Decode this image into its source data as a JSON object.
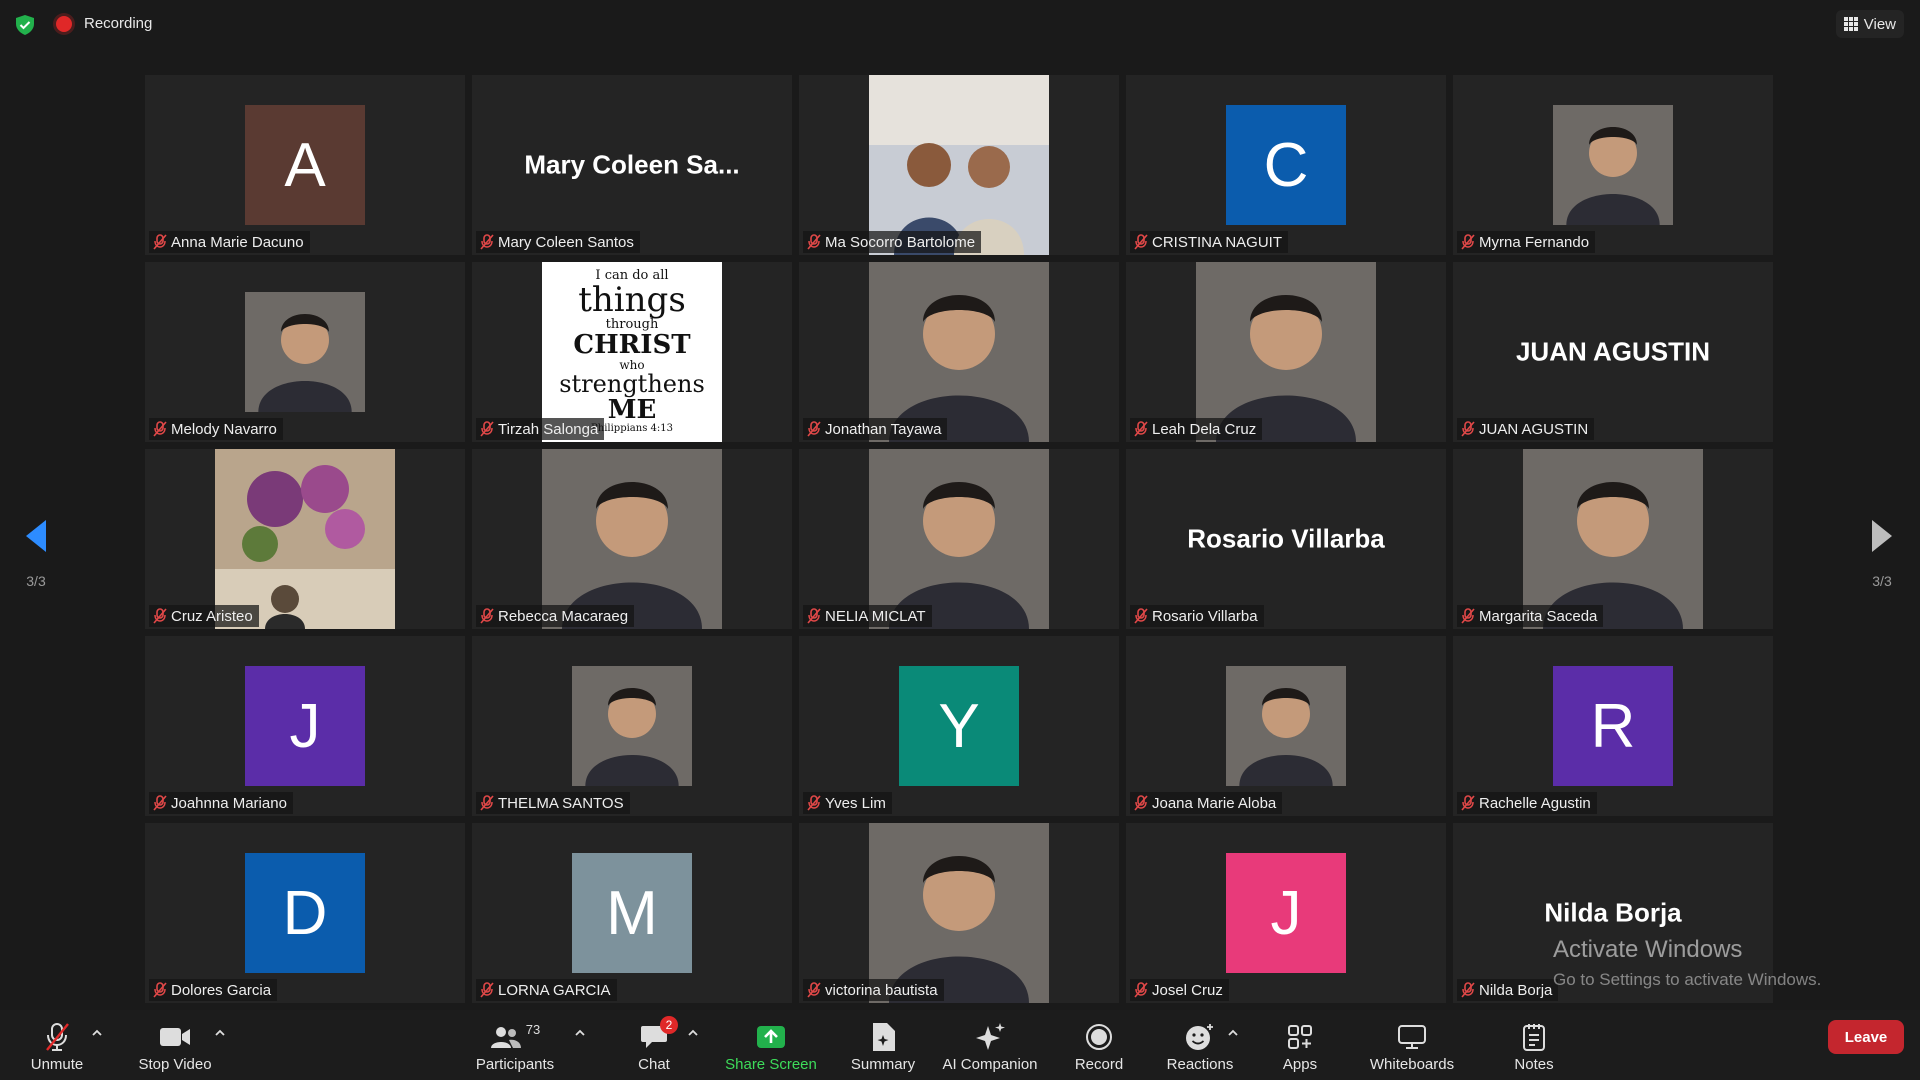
{
  "topbar": {
    "recording_label": "Recording",
    "view_label": "View"
  },
  "pager": {
    "left_page": "3/3",
    "right_page": "3/3"
  },
  "participants": [
    {
      "name": "Anna Marie Dacuno",
      "type": "letter",
      "letter": "A",
      "color": "#5a3a32"
    },
    {
      "name": "Mary Coleen Santos",
      "type": "text",
      "display": "Mary Coleen Sa..."
    },
    {
      "name": "Ma Socorro Bartolome",
      "type": "photo",
      "icon": "couple-photo"
    },
    {
      "name": "CRISTINA NAGUIT",
      "type": "letter",
      "letter": "C",
      "color": "#0b5cad"
    },
    {
      "name": "Myrna Fernando",
      "type": "photo",
      "icon": "portrait-photo",
      "small": true
    },
    {
      "name": "Melody Navarro",
      "type": "photo",
      "icon": "portrait-photo",
      "small": true
    },
    {
      "name": "Tirzah Salonga",
      "type": "quote",
      "lines": [
        "I can do all",
        "things",
        "through",
        "CHRIST",
        "who",
        "strengthens",
        "ME",
        "Philippians 4:13"
      ]
    },
    {
      "name": "Jonathan Tayawa",
      "type": "photo",
      "icon": "portrait-photo"
    },
    {
      "name": "Leah Dela Cruz",
      "type": "photo",
      "icon": "portrait-photo"
    },
    {
      "name": "JUAN AGUSTIN",
      "type": "text",
      "display": "JUAN AGUSTIN"
    },
    {
      "name": "Cruz Aristeo",
      "type": "photo",
      "icon": "flowers-photo"
    },
    {
      "name": "Rebecca Macaraeg",
      "type": "photo",
      "icon": "portrait-photo"
    },
    {
      "name": "NELIA MICLAT",
      "type": "photo",
      "icon": "portrait-photo"
    },
    {
      "name": "Rosario Villarba",
      "type": "text",
      "display": "Rosario Villarba"
    },
    {
      "name": "Margarita Saceda",
      "type": "photo",
      "icon": "portrait-photo"
    },
    {
      "name": "Joahnna Mariano",
      "type": "letter",
      "letter": "J",
      "color": "#5b2da8"
    },
    {
      "name": "THELMA SANTOS",
      "type": "photo",
      "icon": "portrait-photo",
      "small": true
    },
    {
      "name": "Yves Lim",
      "type": "letter",
      "letter": "Y",
      "color": "#0a8a78"
    },
    {
      "name": "Joana Marie Aloba",
      "type": "photo",
      "icon": "portrait-photo",
      "small": true
    },
    {
      "name": "Rachelle Agustin",
      "type": "letter",
      "letter": "R",
      "color": "#5b2da8"
    },
    {
      "name": "Dolores Garcia",
      "type": "letter",
      "letter": "D",
      "color": "#0b5cad"
    },
    {
      "name": "LORNA GARCIA",
      "type": "letter",
      "letter": "M",
      "color": "#7d929c"
    },
    {
      "name": "victorina bautista",
      "type": "photo",
      "icon": "portrait-photo"
    },
    {
      "name": "Josel Cruz",
      "type": "letter",
      "letter": "J",
      "color": "#e83a7a"
    },
    {
      "name": "Nilda Borja",
      "type": "text",
      "display": "Nilda Borja"
    }
  ],
  "watermark": {
    "title": "Activate Windows",
    "subtitle": "Go to Settings to activate Windows."
  },
  "toolbar": {
    "unmute": "Unmute",
    "stop_video": "Stop Video",
    "participants": "Participants",
    "participants_count": "73",
    "chat": "Chat",
    "chat_badge": "2",
    "share_screen": "Share Screen",
    "summary": "Summary",
    "ai_companion": "AI Companion",
    "record": "Record",
    "reactions": "Reactions",
    "apps": "Apps",
    "whiteboards": "Whiteboards",
    "notes": "Notes",
    "leave": "Leave"
  }
}
